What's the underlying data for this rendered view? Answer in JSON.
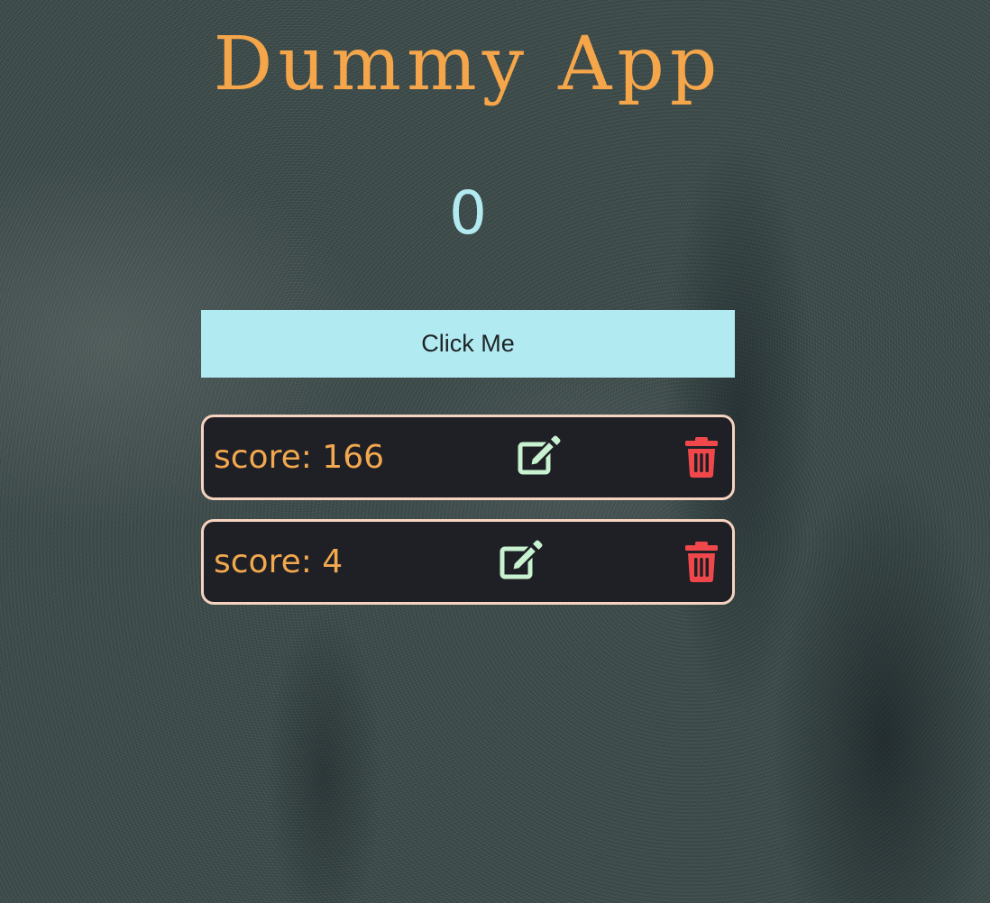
{
  "app": {
    "title": "Dummy App",
    "counter": "0",
    "click_button_label": "Click Me"
  },
  "scores": [
    {
      "label": "score: 166"
    },
    {
      "label": "score: 4"
    }
  ],
  "icons": {
    "edit": "edit-icon",
    "delete": "trash-icon"
  },
  "colors": {
    "title": "#f5a54a",
    "counter": "#b3eaf1",
    "button_bg": "#b1eaf1",
    "row_bg": "#1f1f26",
    "row_border": "#f6d3bf",
    "score_text": "#f2a84e",
    "edit_icon": "#c8f2d0",
    "delete_icon": "#f0484a"
  }
}
